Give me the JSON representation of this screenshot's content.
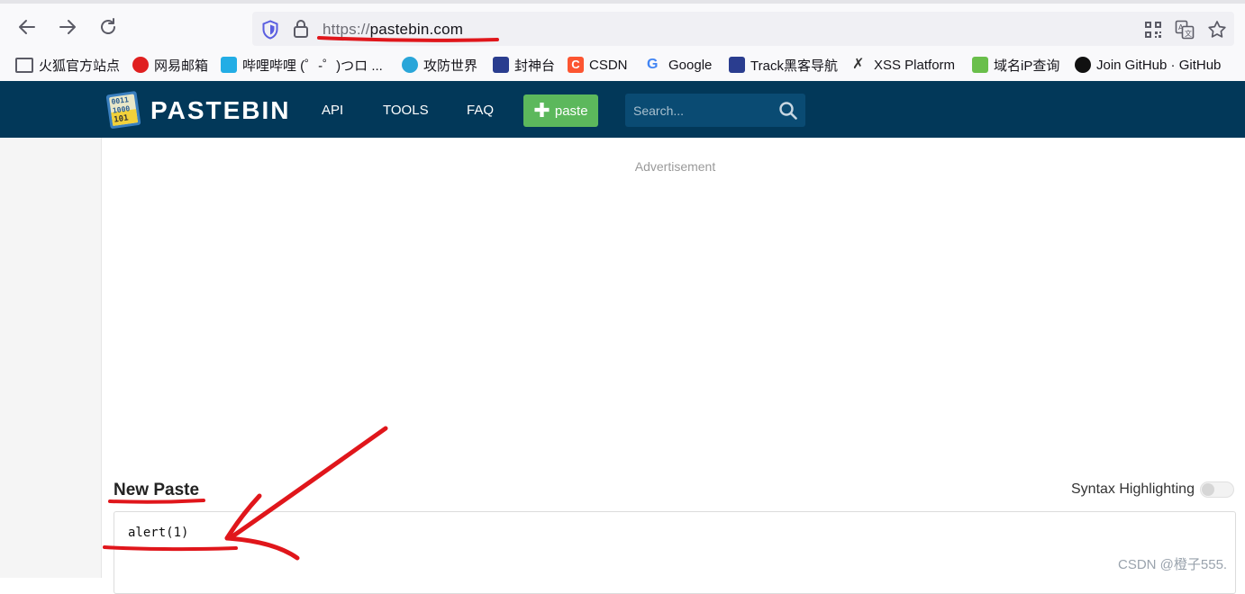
{
  "browser": {
    "url_protocol": "https://",
    "url_host": "pastebin.com",
    "icons": [
      "back-icon",
      "forward-icon",
      "reload-icon",
      "shield-icon",
      "lock-icon",
      "qr-icon",
      "translate-icon",
      "bookmark-star-icon"
    ],
    "bookmarks": [
      {
        "label": "火狐官方站点",
        "icon": "folder-icon",
        "color": "#5b5b66"
      },
      {
        "label": "网易邮箱",
        "icon": "netease-icon",
        "color": "#e02020"
      },
      {
        "label": "哔哩哔哩 (゜-゜)つロ ...",
        "icon": "bilibili-icon",
        "color": "#23ade5"
      },
      {
        "label": "攻防世界",
        "icon": "adworld-icon",
        "color": "#2aa6d9"
      },
      {
        "label": "封神台",
        "icon": "fengshentai-icon",
        "color": "#2a3d8f"
      },
      {
        "label": "CSDN",
        "icon": "csdn-icon",
        "color": "#fc5531"
      },
      {
        "label": "Google",
        "icon": "google-icon",
        "color": "#4285f4"
      },
      {
        "label": "Track黑客导航",
        "icon": "track-icon",
        "color": "#2a3d8f"
      },
      {
        "label": "XSS Platform",
        "icon": "xss-icon",
        "color": "#333333"
      },
      {
        "label": "域名iP查询",
        "icon": "domain-ip-icon",
        "color": "#6abf4b"
      },
      {
        "label": "Join GitHub · GitHub",
        "icon": "github-icon",
        "color": "#111111"
      }
    ]
  },
  "site": {
    "logo_text": "PASTEBIN",
    "logo_digits": "0011 1000 101",
    "nav": [
      "API",
      "TOOLS",
      "FAQ"
    ],
    "new_paste_label": "paste",
    "search_placeholder": "Search..."
  },
  "main": {
    "advertisement_label": "Advertisement",
    "new_paste_title": "New Paste",
    "syntax_label": "Syntax Highlighting",
    "syntax_enabled": false,
    "paste_content": "alert(1)"
  },
  "watermark": "CSDN @橙子555.",
  "colors": {
    "header_bg": "#023859",
    "new_paste_button": "#5cb85c",
    "annotation_red": "#e0161b"
  }
}
